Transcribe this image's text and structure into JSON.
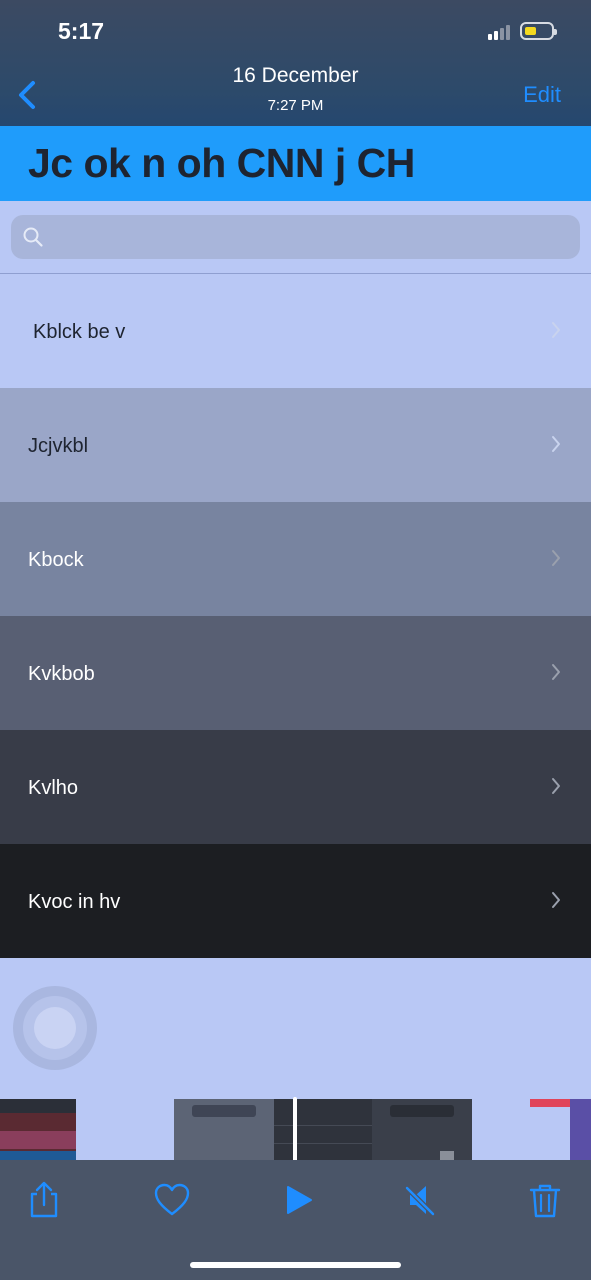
{
  "status_bar": {
    "time": "5:17"
  },
  "nav": {
    "date": "16 December",
    "time": "7:27 PM",
    "edit_label": "Edit"
  },
  "header": {
    "title": "Jc ok n oh CNN j CH"
  },
  "search": {
    "placeholder": ""
  },
  "rows": [
    {
      "label": "Kblck be v",
      "bg": "#b9c8f5",
      "color": "#1e2430"
    },
    {
      "label": "Jcjvkbl",
      "bg": "#9aa6c8",
      "color": "#1e2430"
    },
    {
      "label": "Kbock",
      "bg": "#7884a0",
      "color": "#ffffff"
    },
    {
      "label": "Kvkbob",
      "bg": "#585f73",
      "color": "#ffffff"
    },
    {
      "label": "Kvlho",
      "bg": "#383c48",
      "color": "#ffffff"
    },
    {
      "label": "Kvoc in hv",
      "bg": "#1c1e22",
      "color": "#ffffff"
    }
  ],
  "toolbar": {
    "icons": [
      "share-icon",
      "heart-icon",
      "play-icon",
      "mute-icon",
      "trash-icon"
    ],
    "accent": "#1f8dff"
  },
  "colors": {
    "header": "#1f9cfb",
    "content": "#b9c8f5",
    "accent": "#1f8dff"
  }
}
